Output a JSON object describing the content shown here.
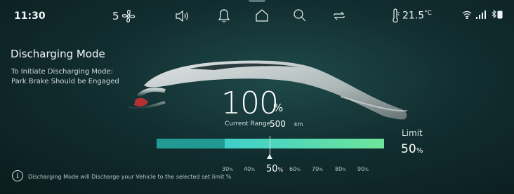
{
  "status_bar": {
    "time": "11:30",
    "fan_level": "5",
    "temperature": "21.5",
    "temperature_unit": "°C"
  },
  "mode": {
    "title": "Discharging Mode",
    "instruction_line1": "To Initiate Discharging Mode:",
    "instruction_line2": "Park Brake Should be Engaged"
  },
  "battery": {
    "percent": "100",
    "percent_unit": "%",
    "range_label": "Current Range",
    "range_value": "500",
    "range_unit": "km"
  },
  "slider": {
    "selected_limit_fraction": 0.5,
    "ticks": [
      {
        "value": "30",
        "unit": "%"
      },
      {
        "value": "40",
        "unit": "%"
      },
      {
        "value": "50",
        "unit": "%"
      },
      {
        "value": "60",
        "unit": "%"
      },
      {
        "value": "70",
        "unit": "%"
      },
      {
        "value": "80",
        "unit": "%"
      },
      {
        "value": "90",
        "unit": "%"
      }
    ]
  },
  "limit": {
    "label": "Limit",
    "value": "50",
    "unit": "%"
  },
  "footer": {
    "info_text": "Discharging Mode will Discharge your Vehicle to the selected set limit %"
  },
  "colors": {
    "bar_used": "#219a93",
    "bar_remaining_start": "#3fcfcb",
    "bar_remaining_end": "#6ee59a"
  },
  "icons": [
    "fan-icon",
    "speaker-icon",
    "bell-icon",
    "home-icon",
    "search-icon",
    "repeat-icon",
    "thermometer-icon",
    "wifi-icon",
    "signal-icon",
    "bluetooth-battery-icon",
    "info-icon"
  ]
}
